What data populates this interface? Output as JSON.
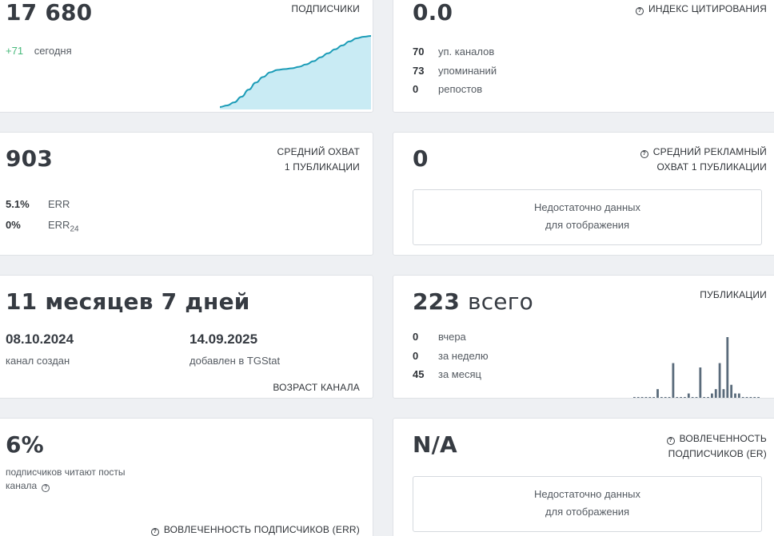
{
  "subscribers": {
    "value": "17 680",
    "title": "ПОДПИСЧИКИ",
    "delta": "+71",
    "delta_label": "сегодня",
    "trend": [
      0,
      2,
      6,
      13,
      22,
      31,
      38,
      44,
      47,
      48,
      49,
      51,
      54,
      58,
      63,
      68,
      73,
      78,
      83,
      87,
      89,
      90
    ],
    "colors": {
      "line": "#1c9cb7",
      "fill": "#c9ebf4",
      "delta": "#47b97b"
    }
  },
  "citation": {
    "value": "0.0",
    "title": "ИНДЕКС ЦИТИРОВАНИЯ",
    "rows": [
      {
        "num": "70",
        "label": "уп. каналов"
      },
      {
        "num": "73",
        "label": "упоминаний"
      },
      {
        "num": "0",
        "label": "репостов"
      }
    ]
  },
  "reach": {
    "value": "903",
    "title_line1": "СРЕДНИЙ ОХВАТ",
    "title_line2": "1 ПУБЛИКАЦИИ",
    "err_value": "5.1%",
    "err_label": "ERR",
    "err24_value": "0%",
    "err24_label": "ERR",
    "err24_sub": "24"
  },
  "ad_reach": {
    "value": "0",
    "title_line1": "СРЕДНИЙ РЕКЛАМНЫЙ",
    "title_line2": "ОХВАТ 1 ПУБЛИКАЦИИ",
    "nodata_line1": "Недостаточно данных",
    "nodata_line2": "для отображения"
  },
  "age": {
    "value": "11 месяцев 7 дней",
    "created_date": "08.10.2024",
    "created_label": "канал создан",
    "added_date": "14.09.2025",
    "added_label": "добавлен в TGStat",
    "title": "ВОЗРАСТ КАНАЛА"
  },
  "posts": {
    "value_num": "223",
    "value_word": "всего",
    "title": "ПУБЛИКАЦИИ",
    "rows": [
      {
        "num": "0",
        "label": "вчера"
      },
      {
        "num": "0",
        "label": "за неделю"
      },
      {
        "num": "45",
        "label": "за месяц"
      }
    ],
    "bars": [
      0,
      0,
      0,
      0,
      0,
      0,
      2,
      0,
      0,
      0,
      8,
      0,
      0,
      0,
      1,
      0,
      0,
      7,
      0,
      0,
      1,
      2,
      8,
      2,
      14,
      3,
      1,
      1,
      0,
      0,
      0,
      0,
      0
    ],
    "colors": {
      "bar": "#5a6b7b"
    }
  },
  "err": {
    "value": "6%",
    "desc_line1": "подписчиков читают посты",
    "desc_line2": "канала",
    "title": "ВОВЛЕЧЕННОСТЬ ПОДПИСЧИКОВ (ERR)"
  },
  "er": {
    "value": "N/A",
    "title_line1": "ВОВЛЕЧЕННОСТЬ",
    "title_line2": "ПОДПИСЧИКОВ (ER)",
    "nodata_line1": "Недостаточно данных",
    "nodata_line2": "для отображения"
  }
}
